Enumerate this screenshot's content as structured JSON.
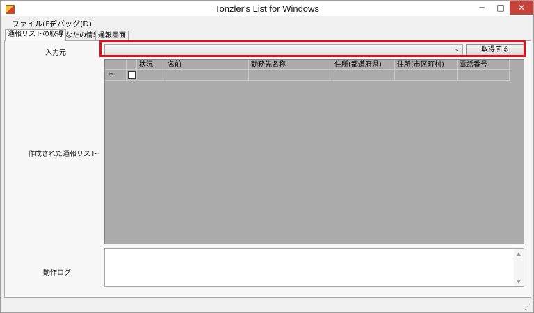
{
  "window": {
    "title": "Tonzler's List for Windows",
    "controls": {
      "minimize": "─",
      "maximize": "□",
      "close": "✕"
    }
  },
  "menu": [
    "ファイル(F)",
    "デバッグ(D)"
  ],
  "tabs": [
    {
      "label": "通報リストの取得",
      "active": true
    },
    {
      "label": "あなたの情報",
      "active": false
    },
    {
      "label": "通報画面",
      "active": false
    }
  ],
  "form": {
    "input_source_label": "入力元",
    "input_source_value": "",
    "fetch_button": "取得する",
    "created_list_label": "作成された通報リスト",
    "log_label": "動作ログ",
    "log_text": ""
  },
  "grid": {
    "new_row_marker": "*",
    "columns": [
      "状況",
      "名前",
      "勤務先名称",
      "住所(都道府県)",
      "住所(市区町村)",
      "電話番号"
    ]
  },
  "icons": {
    "app": "app-icon",
    "combo": "chevron-down-icon",
    "scroll_up": "▲",
    "scroll_down": "▼",
    "grip": "⋰"
  },
  "colors": {
    "highlight": "#e0101a",
    "grid_background": "#ababab",
    "close_button": "#c7433a"
  }
}
